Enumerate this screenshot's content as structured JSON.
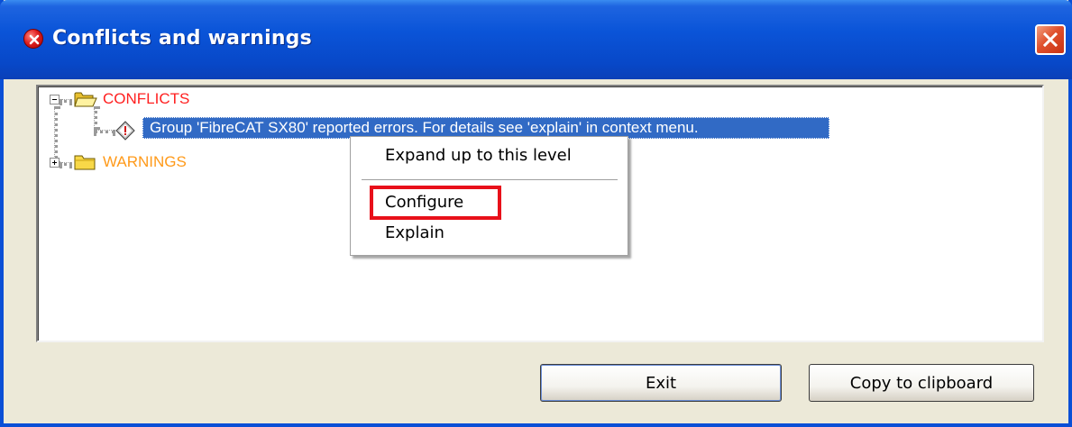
{
  "window": {
    "title": "Conflicts and warnings",
    "title_icon": "error-icon",
    "close_icon": "close-icon"
  },
  "tree": {
    "nodes": [
      {
        "label": "CONFLICTS",
        "color": "#ff2020",
        "expanded": true,
        "icon": "open-folder-icon",
        "children": [
          {
            "label": "Group 'FibreCAT SX80' reported errors. For details see 'explain' in context menu.",
            "icon": "error-diamond-icon",
            "selected": true
          }
        ]
      },
      {
        "label": "WARNINGS",
        "color": "#ff9a1a",
        "expanded": false,
        "icon": "closed-folder-icon"
      }
    ]
  },
  "context_menu": {
    "items": [
      {
        "label": "Expand up to this level"
      },
      {
        "label": "Configure",
        "highlighted": true
      },
      {
        "label": "Explain"
      }
    ]
  },
  "buttons": {
    "exit": "Exit",
    "copy": "Copy to clipboard"
  },
  "colors": {
    "titlebar": "#0a54d8",
    "selection": "#316ac5",
    "highlight_box": "#e8101a",
    "dialog_bg": "#ece9d8"
  }
}
